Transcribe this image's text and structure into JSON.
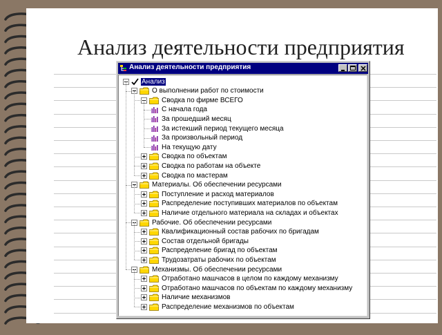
{
  "slide": {
    "title": "Анализ деятельности предприятия"
  },
  "window": {
    "title": "Анализ деятельности предприятия",
    "title_icon": "tree-app-icon",
    "controls": [
      "minimize",
      "maximize",
      "close"
    ]
  },
  "tree": {
    "root": {
      "label": "Анализ",
      "icon": "checkmark-icon",
      "selected": true
    },
    "groups": [
      {
        "label": "О выполнении работ по стоимости",
        "items": [
          {
            "label": "Сводка по фирме ВСЕГО",
            "expanded": true,
            "children": [
              {
                "label": "С начала года"
              },
              {
                "label": "За прошедший месяц"
              },
              {
                "label": "За истекший период текущего месяца"
              },
              {
                "label": "За произвольный период"
              },
              {
                "label": "На текущую дату"
              }
            ]
          },
          {
            "label": "Сводка по объектам"
          },
          {
            "label": "Сводка по работам на объекте"
          },
          {
            "label": "Сводка по мастерам"
          }
        ]
      },
      {
        "label": "Материалы. Об обеспечении ресурсами",
        "items": [
          {
            "label": "Поступление и расход материалов"
          },
          {
            "label": "Распределение поступивших материалов по объектам"
          },
          {
            "label": "Наличие отдельного материала на складах и объектах"
          }
        ]
      },
      {
        "label": "Рабочие. Об обеспечении ресурсами",
        "items": [
          {
            "label": "Квалификационный состав рабочих по бригадам"
          },
          {
            "label": "Состав отдельной бригады"
          },
          {
            "label": "Распределение бригад по объектам"
          },
          {
            "label": "Трудозатраты рабочих по объектам"
          }
        ]
      },
      {
        "label": "Механизмы. Об обеспечении ресурсами",
        "items": [
          {
            "label": "Отработано машчасов в целом по каждому механизму"
          },
          {
            "label": "Отработано машчасов по объектам по каждому механизму"
          },
          {
            "label": "Наличие механизмов"
          },
          {
            "label": "Распределение механизмов по объектам"
          }
        ]
      }
    ]
  },
  "colors": {
    "titlebar": "#000080",
    "folder": "#ffd700",
    "report_icon": "#7a1fa2",
    "selection": "#000080"
  }
}
